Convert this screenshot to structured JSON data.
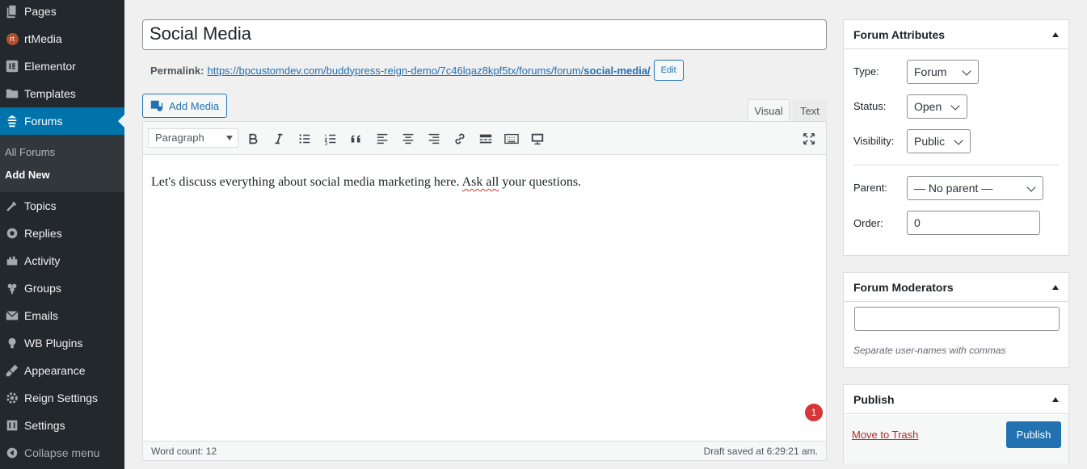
{
  "sidebar": {
    "items": [
      {
        "label": "Pages",
        "icon": "pages-icon"
      },
      {
        "label": "rtMedia",
        "icon": "rtmedia-icon"
      },
      {
        "label": "Elementor",
        "icon": "elementor-icon"
      },
      {
        "label": "Templates",
        "icon": "templates-icon"
      },
      {
        "label": "Forums",
        "icon": "forums-icon"
      },
      {
        "label": "Topics",
        "icon": "topics-icon"
      },
      {
        "label": "Replies",
        "icon": "replies-icon"
      },
      {
        "label": "Activity",
        "icon": "activity-icon"
      },
      {
        "label": "Groups",
        "icon": "groups-icon"
      },
      {
        "label": "Emails",
        "icon": "emails-icon"
      },
      {
        "label": "WB Plugins",
        "icon": "bulb-icon"
      },
      {
        "label": "Appearance",
        "icon": "appearance-icon"
      },
      {
        "label": "Reign Settings",
        "icon": "gear-icon"
      },
      {
        "label": "Settings",
        "icon": "settings-icon"
      },
      {
        "label": "Collapse menu",
        "icon": "collapse-icon"
      }
    ],
    "submenu": [
      {
        "label": "All Forums"
      },
      {
        "label": "Add New"
      }
    ],
    "rtmedia_badge": "rt",
    "active_color": "#0073aa"
  },
  "editor": {
    "title": "Social Media",
    "permalink_label": "Permalink:",
    "permalink_base": "https://bpcustomdev.com/buddypress-reign-demo/7c46lqaz8kpf5tx/forums/forum/",
    "permalink_slug": "social-media/",
    "edit_label": "Edit",
    "add_media_label": "Add Media",
    "tab_visual": "Visual",
    "tab_text": "Text",
    "format_value": "Paragraph",
    "content_before": "Let's discuss everything about social media marketing here. ",
    "content_spell": "Ask  all",
    "content_after": " your questions.",
    "notification_count": "1",
    "word_count": "Word count: 12",
    "draft_saved": "Draft saved at 6:29:21 am."
  },
  "forum_attributes": {
    "title": "Forum Attributes",
    "type_label": "Type:",
    "type_value": "Forum",
    "status_label": "Status:",
    "status_value": "Open",
    "visibility_label": "Visibility:",
    "visibility_value": "Public",
    "parent_label": "Parent:",
    "parent_value": "— No parent —",
    "order_label": "Order:",
    "order_value": "0"
  },
  "forum_moderators": {
    "title": "Forum Moderators",
    "input_value": "",
    "hint": "Separate user-names with commas"
  },
  "publish": {
    "title": "Publish",
    "trash_label": "Move to Trash",
    "publish_label": "Publish",
    "accent": "#2271b1"
  }
}
